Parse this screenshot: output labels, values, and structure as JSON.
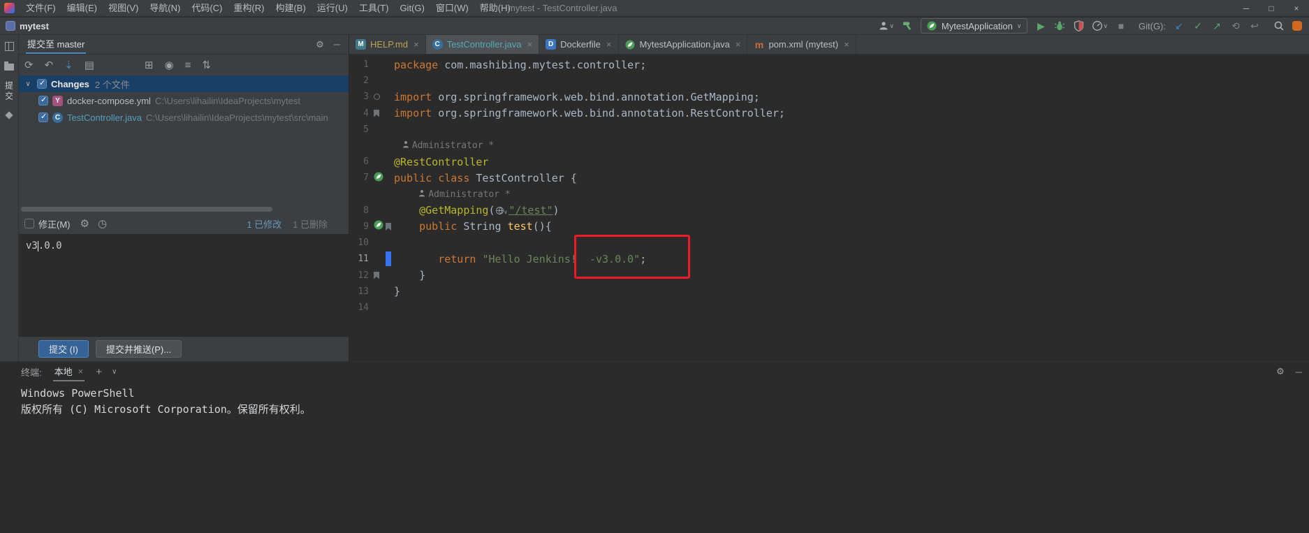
{
  "colors": {
    "accent_blue": "#4a88c7",
    "selection_blue": "#1a3f66",
    "annotation_red": "#ed1c24",
    "commit_button_blue": "#366395",
    "spring_green": "#4c9e57"
  },
  "titlebar": {
    "menus": [
      "文件(F)",
      "编辑(E)",
      "视图(V)",
      "导航(N)",
      "代码(C)",
      "重构(R)",
      "构建(B)",
      "运行(U)",
      "工具(T)",
      "Git(G)",
      "窗口(W)",
      "帮助(H)"
    ],
    "title": "mytest - TestController.java"
  },
  "toolbar": {
    "project_name": "mytest",
    "run_config": "MytestApplication",
    "git_label": "Git(G):"
  },
  "left_stripe": {
    "commit_label": "提交"
  },
  "commit_panel": {
    "header_tab": "提交至 master",
    "changes": {
      "label": "Changes",
      "count": "2 个文件"
    },
    "files": [
      {
        "name": "docker-compose.yml",
        "path": "C:\\Users\\lihailin\\IdeaProjects\\mytest",
        "icon": "yaml",
        "color": "#bcbec4"
      },
      {
        "name": "TestController.java",
        "path": "C:\\Users\\lihailin\\IdeaProjects\\mytest\\src\\main",
        "icon": "class",
        "color": "#549ebc"
      }
    ],
    "amend_label": "修正(M)",
    "stats": {
      "modified": "1 已修改",
      "deleted": "1 已删除"
    },
    "message_before_caret": "v3",
    "message_after_caret": ".0.0",
    "commit_button": "提交 (I)",
    "commit_push_button": "提交并推送(P)..."
  },
  "commit_toolbar": {
    "left": [
      {
        "name": "refresh-icon",
        "glyph": "⟳",
        "color": "#9da0a2"
      },
      {
        "name": "rollback-icon",
        "glyph": "↶",
        "color": "#9da0a2"
      },
      {
        "name": "shelve-icon",
        "glyph": "⇣",
        "color": "#4a88c7"
      },
      {
        "name": "patch-icon",
        "glyph": "▤",
        "color": "#9da0a2"
      }
    ],
    "right": [
      {
        "name": "group-by-icon",
        "glyph": "⊞",
        "color": "#9da0a2"
      },
      {
        "name": "view-options-icon",
        "glyph": "◉",
        "color": "#9da0a2"
      },
      {
        "name": "filter-icon",
        "glyph": "≡",
        "color": "#9da0a2"
      },
      {
        "name": "expand-collapse-icon",
        "glyph": "⇅",
        "color": "#9da0a2"
      }
    ]
  },
  "editor": {
    "tabs": [
      {
        "label": "HELP.md",
        "icon": "md",
        "active": false,
        "color": "#b8a24f"
      },
      {
        "label": "TestController.java",
        "icon": "class",
        "active": true,
        "color": "#56a8b7"
      },
      {
        "label": "Dockerfile",
        "icon": "docker",
        "active": false,
        "color": "#bcbec4"
      },
      {
        "label": "MytestApplication.java",
        "icon": "spring",
        "active": false,
        "color": "#bcbec4"
      },
      {
        "label": "pom.xml (mytest)",
        "icon": "maven",
        "active": false,
        "color": "#bcbec4"
      }
    ],
    "code_lines": [
      {
        "n": "1",
        "segs": [
          [
            "kw",
            "package "
          ],
          [
            "pl",
            "com.mashibing.mytest.controller;"
          ]
        ]
      },
      {
        "n": "2",
        "segs": []
      },
      {
        "n": "3",
        "g": [
          "gear"
        ],
        "segs": [
          [
            "kw",
            "import "
          ],
          [
            "pl",
            "org.springframework.web.bind.annotation.GetMapping;"
          ]
        ]
      },
      {
        "n": "4",
        "g": [
          "flag"
        ],
        "segs": [
          [
            "kw",
            "import "
          ],
          [
            "pl",
            "org.springframework.web.bind.annotation.RestController;"
          ]
        ]
      },
      {
        "n": "5",
        "segs": []
      },
      {
        "hint": " Administrator *"
      },
      {
        "n": "6",
        "segs": [
          [
            "ann",
            "@RestController"
          ]
        ]
      },
      {
        "n": "7",
        "g": [
          "spring"
        ],
        "segs": [
          [
            "kw",
            "public class "
          ],
          [
            "pl",
            "TestController {"
          ]
        ]
      },
      {
        "hint": "    Administrator *"
      },
      {
        "n": "8",
        "segs": [
          [
            "ann",
            "    @GetMapping"
          ],
          [
            "pl",
            "("
          ],
          [
            "globe",
            ""
          ],
          [
            "lnk",
            "\"/test\""
          ],
          [
            "pl",
            ")"
          ]
        ]
      },
      {
        "n": "9",
        "g": [
          "spring",
          "flag"
        ],
        "segs": [
          [
            "kw",
            "    public "
          ],
          [
            "pl",
            "String "
          ],
          [
            "mth",
            "test"
          ],
          [
            "pl",
            "(){"
          ]
        ]
      },
      {
        "n": "10",
        "segs": []
      },
      {
        "n": "11",
        "cur": true,
        "segs": [
          [
            "kw",
            "       return "
          ],
          [
            "str",
            "\"Hello Jenkins!  -v3.0.0\""
          ],
          [
            "pl",
            ";"
          ]
        ]
      },
      {
        "n": "12",
        "g": [
          "flag"
        ],
        "segs": [
          [
            "pl",
            "    }"
          ]
        ]
      },
      {
        "n": "13",
        "segs": [
          [
            "pl",
            "}"
          ]
        ]
      },
      {
        "n": "14",
        "segs": []
      }
    ]
  },
  "terminal": {
    "label": "终端:",
    "tab": "本地",
    "lines": [
      "Windows PowerShell",
      "版权所有 (C) Microsoft Corporation。保留所有权利。"
    ]
  },
  "icons": {
    "minimize": "─",
    "maximize": "□",
    "close": "×",
    "chevron_down": "∨",
    "plus": "+",
    "gear": "⚙",
    "minus": "─",
    "clock": "◷",
    "run": "▶",
    "stop": "■",
    "git_update": "↙",
    "git_commit": "✓",
    "git_push": "↗",
    "history": "⟲",
    "undo": "↩",
    "tree_chevron": "∨",
    "tab_close": "×"
  }
}
